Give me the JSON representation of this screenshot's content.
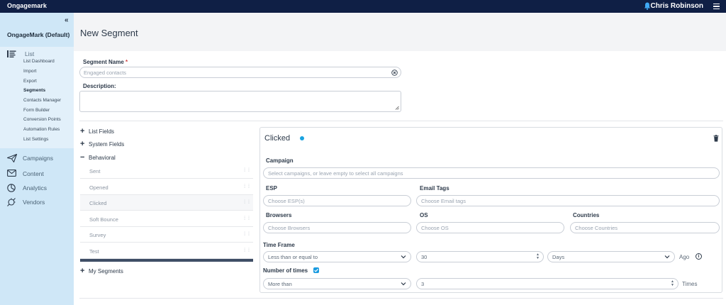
{
  "app": {
    "brand": "Ongagemark",
    "user_name": "Chris Robinson"
  },
  "sidebar": {
    "account": "OngageMark (Default)",
    "list_section": {
      "label": "List",
      "items": [
        {
          "label": "List Dashboard"
        },
        {
          "label": "Import"
        },
        {
          "label": "Export"
        },
        {
          "label": "Segments",
          "active": true
        },
        {
          "label": "Contacts Manager"
        },
        {
          "label": "Form Builder"
        },
        {
          "label": "Conversion Points"
        },
        {
          "label": "Automation Rules"
        },
        {
          "label": "List Settings"
        }
      ]
    },
    "nav": [
      {
        "label": "Campaigns",
        "icon": "paper-plane-icon"
      },
      {
        "label": "Content",
        "icon": "envelope-icon"
      },
      {
        "label": "Analytics",
        "icon": "pie-chart-icon"
      },
      {
        "label": "Vendors",
        "icon": "plug-icon"
      }
    ]
  },
  "page": {
    "title": "New Segment"
  },
  "form": {
    "segment_name_label": "Segment Name",
    "required_mark": "*",
    "segment_name_value": "Engaged contacts",
    "description_label": "Description:"
  },
  "fields_tree": {
    "list_fields": "List Fields",
    "system_fields": "System Fields",
    "behavioral": "Behavioral",
    "behavioral_items": [
      "Sent",
      "Opened",
      "Clicked",
      "Soft Bounce",
      "Survey",
      "Test"
    ],
    "my_segments": "My Segments",
    "plus_sign": "+",
    "minus_sign": "−",
    "grip_glyph": "⁞ ⁞"
  },
  "condition": {
    "title": "Clicked",
    "campaign_label": "Campaign",
    "campaign_placeholder": "Select campaigns, or leave empty to select all campaigns",
    "esp_label": "ESP",
    "esp_placeholder": "Choose ESP(s)",
    "email_tags_label": "Email Tags",
    "email_tags_placeholder": "Choose Email tags",
    "browsers_label": "Browsers",
    "browsers_placeholder": "Choose Browsers",
    "os_label": "OS",
    "os_placeholder": "Choose OS",
    "countries_label": "Countries",
    "countries_placeholder": "Choose Countries",
    "time_frame_label": "Time Frame",
    "time_frame_operator": "Less than or equal to",
    "time_frame_value": "30",
    "time_frame_unit": "Days",
    "ago_label": "Ago",
    "info_glyph": "i",
    "number_of_times_label": "Number of times",
    "number_of_times_checked": true,
    "times_operator": "More than",
    "times_value": "3",
    "times_label": "Times"
  },
  "colors": {
    "topbar": "#0f1f45",
    "sidebar": "#cfe7f7",
    "accent": "#1aa3e0",
    "required": "#d04545"
  }
}
